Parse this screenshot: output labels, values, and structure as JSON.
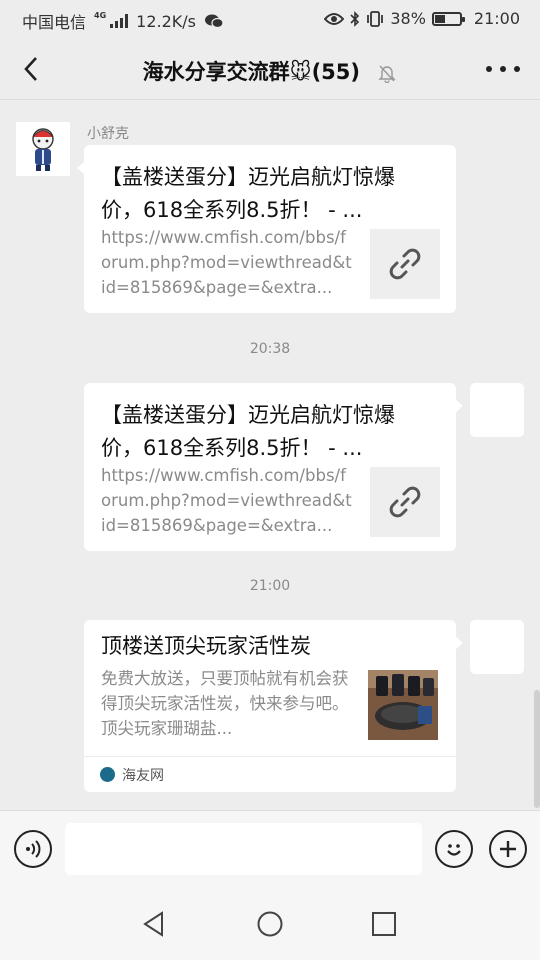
{
  "status_bar": {
    "carrier": "中国电信",
    "network": "4G",
    "speed": "12.2K/s",
    "battery": "38%",
    "battery_level": 0.38,
    "time": "21:00"
  },
  "header": {
    "title": "海水分享交流群🐭(55)",
    "back_icon": "chevron-left-icon",
    "mute_icon": "bell-off-icon",
    "more_icon": "more-dots-icon"
  },
  "messages": [
    {
      "sender": "小舒克",
      "title": "【盖楼送蛋分】迈光启航灯惊爆价，618全系列8.5折！ - ...",
      "desc": "https://www.cmfish.com/bbs/forum.php?mod=viewthread&tid=815869&page=&extra..."
    },
    {
      "time": "20:38",
      "title": "【盖楼送蛋分】迈光启航灯惊爆价，618全系列8.5折！ - ...",
      "desc": "https://www.cmfish.com/bbs/forum.php?mod=viewthread&tid=815869&page=&extra..."
    },
    {
      "time": "21:00",
      "title": "顶楼送顶尖玩家活性炭",
      "desc": "免费大放送，只要顶帖就有机会获得顶尖玩家活性炭，快来参与吧。顶尖玩家珊瑚盐...",
      "source": "海友网"
    }
  ],
  "input_bar": {
    "voice_icon": "voice-icon",
    "emoji_icon": "emoji-icon",
    "add_icon": "plus-icon",
    "placeholder": ""
  },
  "nav_bar": {
    "back": "triangle-back-icon",
    "home": "circle-home-icon",
    "recent": "square-recent-icon"
  },
  "colors": {
    "background": "#ededed",
    "bubble": "#ffffff",
    "meta_text": "#8a8a8a"
  }
}
